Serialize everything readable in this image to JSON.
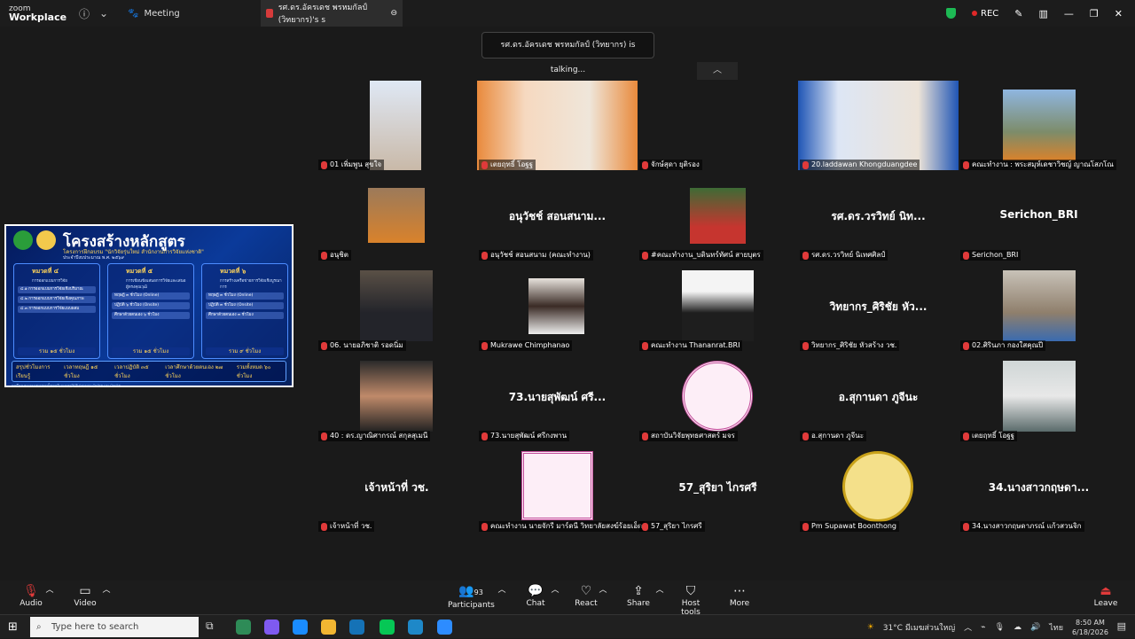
{
  "titlebar": {
    "logo_line1": "zoom",
    "logo_line2": "Workplace",
    "meeting_tab": "Meeting",
    "active_tab": "รศ.ดร.อัครเดช พรหมกัลป์ (วิทยากร)'s s",
    "rec_label": "REC"
  },
  "speaking_banner": "รศ.ดร.อัครเดช พรหมกัลป์ (วิทยากร) is talking...",
  "shared_screen": {
    "title": "โครงสร้างหลักสูตร",
    "subtitle": "โครงการฝึกอบรม \"นักวิจัยรุ่นใหม่ สำนักงานการวิจัยแห่งชาติ\"",
    "subtitle2": "ประจำปีงบประมาณ พ.ศ. ๒๕๖๙",
    "units": [
      {
        "title": "หมวดที่ ๔",
        "sub": "การออกแบบการวิจัย",
        "items": [
          "๔.๑ การออกแบบการวิจัยเชิงปริมาณ",
          "๔.๒ การออกแบบการวิจัยเชิงคุณภาพ",
          "๔.๓ การออกแบบการวิจัยแบบผสม"
        ],
        "total": "รวม ๑๕ ชั่วโมง"
      },
      {
        "title": "หมวดที่ ๕",
        "sub": "การเขียนข้อเสนอการวิจัยและเสนอผู้ทรงคุณวุฒิ",
        "items": [
          "ทฤษฎี ๓ ชั่วโมง (Online)",
          "ปฏิบัติ ๖ ชั่วโมง (Onsite)",
          "ศึกษาด้วยตนเอง ๖ ชั่วโมง"
        ],
        "total": "รวม ๑๕ ชั่วโมง"
      },
      {
        "title": "หมวดที่ ๖",
        "sub": "การสร้างเครือข่ายการวิจัยเชิงบูรณาการ",
        "items": [
          "ทฤษฎี ๓ ชั่วโมง (Online)",
          "ปฏิบัติ ๓ ชั่วโมง (Onsite)",
          "ศึกษาด้วยตนเอง ๓ ชั่วโมง"
        ],
        "total": "รวม ๙ ชั่วโมง"
      }
    ],
    "footer": [
      "สรุปชั่วโมงการเรียนรู้",
      "เวลาทฤษฎี ๑๕ ชั่วโมง",
      "เวลาปฏิบัติ ๓๕ ชั่วโมง",
      "เวลาศึกษาด้วยตนเอง ๒๗ ชั่วโมง",
      "รวมทั้งหมด ๖๐ ชั่วโมง"
    ],
    "fine_print": "การฝึกอบรมแบบผสมผสานทั้งทฤษฎีและการปฏิบัติ ผ่านระบบ Online และ Onsite"
  },
  "participants": [
    {
      "label": "01 เพิ่มพูน สุขใจ",
      "big": ""
    },
    {
      "label": "เตยฤทธิ์ โอฐฐ",
      "big": ""
    },
    {
      "label": "จักษ์สุดา ยุติรอง",
      "big": ""
    },
    {
      "label": "20.laddawan  Khongduangdee",
      "big": ""
    },
    {
      "label": "คณะทำงาน : พระสมุห์เดชาวิชญ์ ญาณโสภโณ",
      "big": ""
    },
    {
      "label": "อนุชิต",
      "big": ""
    },
    {
      "label": "อนุวัชช์ สอนสนาม (คณะทำงาน)",
      "big": "อนุวัชช์ สอนสนาม..."
    },
    {
      "label": "#คณะทำงาน_บดินทร์ทัศน์ สายบุตร",
      "big": ""
    },
    {
      "label": "รศ.ดร.วรวิทย์ นิเทศศิลป์",
      "big": "รศ.ดร.วรวิทย์ นิท..."
    },
    {
      "label": "Serichon_BRI",
      "big": "Serichon_BRI"
    },
    {
      "label": "06. นายอภิชาติ รอดนิ่ม",
      "big": ""
    },
    {
      "label": "Mukrawe Chimphanao",
      "big": ""
    },
    {
      "label": "คณะทำงาน Thananrat.BRI",
      "big": ""
    },
    {
      "label": "วิทยากร_ศิริชัย หัวสร้าง วช.",
      "big": "วิทยากร_ศิริชัย หัว..."
    },
    {
      "label": "02.ศิรินภา กองใสคุณปี",
      "big": ""
    },
    {
      "label": "40 : ดร.ญาณิศากรณ์ สกุลสุเมนี",
      "big": ""
    },
    {
      "label": "73.นายสุพัฒน์ ศรีกงพาน",
      "big": "73.นายสุพัฒน์ ศรี..."
    },
    {
      "label": "สถาบันวิจัยพุทธศาสตร์ มจร",
      "big": ""
    },
    {
      "label": "อ.สุกานดา ภูจีนะ",
      "big": "อ.สุกานดา ภูจีนะ"
    },
    {
      "label": "เตยฤทธิ์ โอฐฐ",
      "big": ""
    },
    {
      "label": "เจ้าหน้าที่ วช.",
      "big": "เจ้าหน้าที่ วช."
    },
    {
      "label": "คณะทำงาน นายจักรี มาร์ดนี วิทยาลัยสงฆ์ร้อยเอ็ด",
      "big": ""
    },
    {
      "label": "57_สุริยา ไกรศรี",
      "big": "57_สุริยา ไกรศรี"
    },
    {
      "label": "Pm Supawat Boonthong",
      "big": ""
    },
    {
      "label": "34.นางสาวกฤษดาภรณ์ แก้วสวนจิก",
      "big": "34.นางสาวกฤษดา..."
    }
  ],
  "toolbar": {
    "audio": "Audio",
    "video": "Video",
    "participants": "Participants",
    "participants_count": "93",
    "chat": "Chat",
    "react": "React",
    "share": "Share",
    "host_tools": "Host tools",
    "more": "More",
    "leave": "Leave"
  },
  "taskbar": {
    "search_placeholder": "Type here to search",
    "weather": "31°C  มีเมฆส่วนใหญ่",
    "lang": "ไทย",
    "time": "8:50 AM",
    "date": "6/18/2026"
  },
  "colors": {
    "mic_off": "#e03a3a",
    "rec": "#e02828",
    "shield": "#1db954",
    "slide_bg": "#0b3a9a"
  }
}
